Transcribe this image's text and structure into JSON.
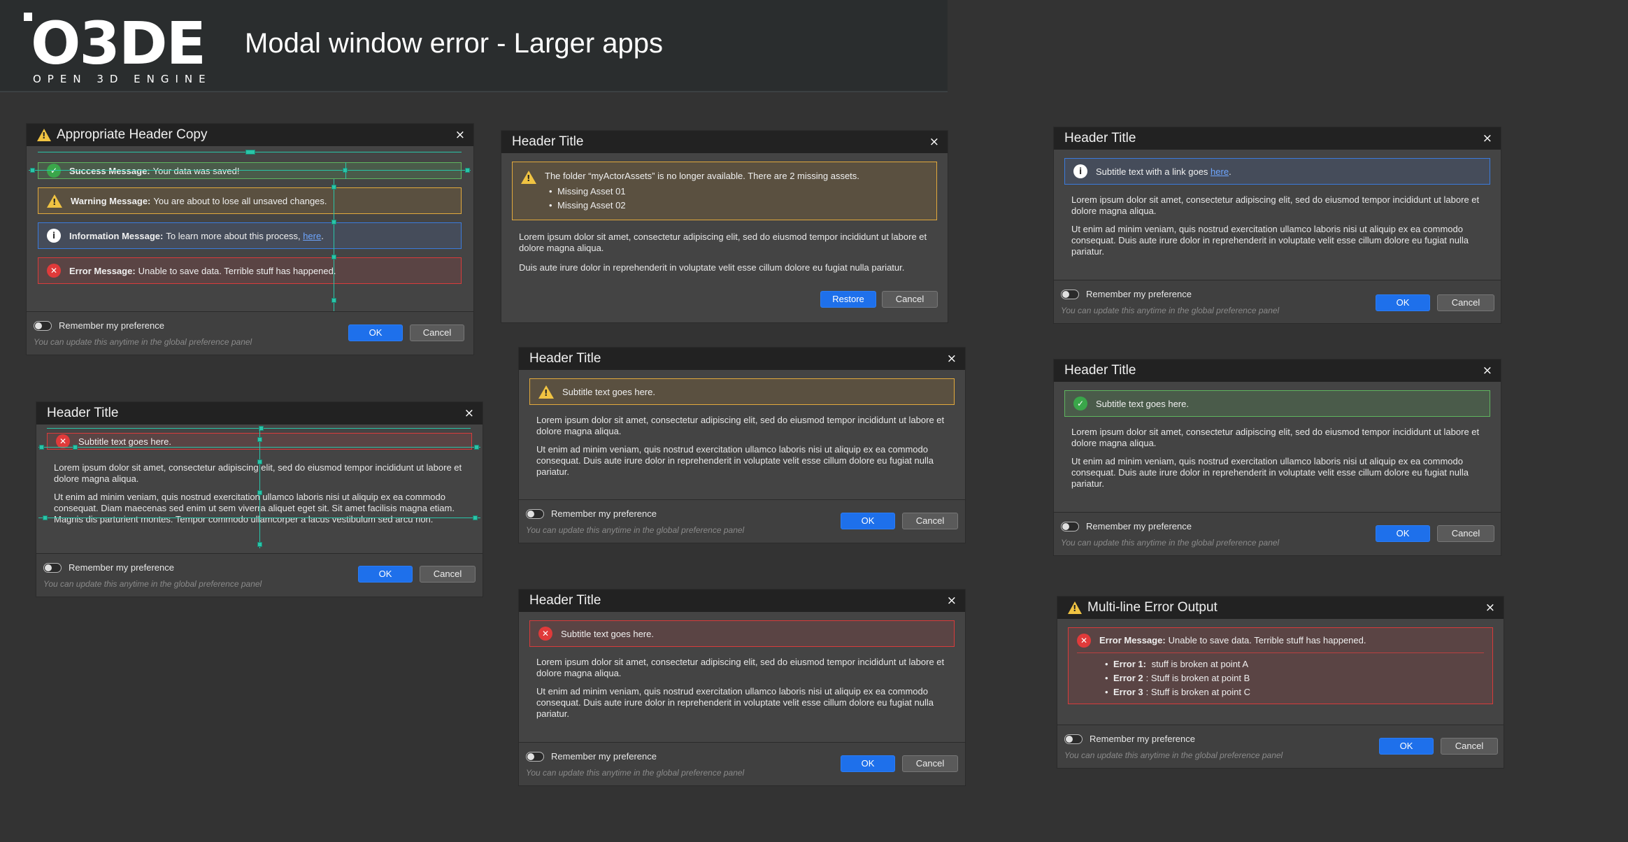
{
  "page": {
    "title": "Modal window error - Larger apps"
  },
  "logo": {
    "main": "O3DE",
    "sub": "OPEN 3D ENGINE"
  },
  "common": {
    "ok": "OK",
    "cancel": "Cancel",
    "restore": "Restore",
    "remember": "Remember my preference",
    "hint": "You can update this anytime in the global preference panel",
    "close": "×",
    "lorem1": "Lorem ipsum dolor sit amet, consectetur adipiscing elit, sed do eiusmod tempor incididunt ut labore et dolore magna aliqua.",
    "lorem2": "Ut enim ad minim veniam, quis nostrud exercitation ullamco laboris nisi ut aliquip ex ea commodo consequat. Duis aute irure dolor in reprehenderit in voluptate velit esse cillum dolore eu fugiat nulla pariatur.",
    "lorem3": "Duis aute irure dolor in reprehenderit in voluptate velit esse cillum dolore eu fugiat nulla pariatur.",
    "lorem4": "Ut enim ad minim veniam, quis nostrud exercitation ullamco laboris nisi ut aliquip ex ea commodo consequat. Diam maecenas sed enim ut sem viverra aliquet eget sit. Sit amet facilisis magna etiam. Magnis dis parturient montes. Tempor commodo ullamcorper a lacus vestibulum sed arcu non.",
    "subtitle": "Subtitle text goes here."
  },
  "m1": {
    "title": "Appropriate Header Copy",
    "success_label": "Success Message:",
    "success_text": "Your data was saved!",
    "warning_label": "Warning Message:",
    "warning_text": "You are about to lose all unsaved changes.",
    "info_label": "Information Message:",
    "info_text": "To learn more about this process, ",
    "info_link": "here",
    "error_label": "Error Message:",
    "error_text": "Unable to save data. Terrible stuff has happened.",
    "guide_label": "8px"
  },
  "m2": {
    "title": "Header Title",
    "warn_text": "The folder “myActorAssets” is no longer available. There are 2 missing assets.",
    "assets": [
      "Missing Asset 01",
      "Missing Asset 02"
    ]
  },
  "m3": {
    "title": "Header Title",
    "info_text": "Subtitle text with a link goes ",
    "info_link": "here"
  },
  "m4": {
    "title": "Header Title"
  },
  "m5": {
    "title": "Header Title"
  },
  "m6": {
    "title": "Header Title"
  },
  "m7": {
    "title": "Header Title"
  },
  "m8": {
    "title": "Multi-line Error Output",
    "error_label": "Error Message:",
    "error_text": "Unable to save data. Terrible stuff has happened.",
    "errors": [
      {
        "label": "Error 1:",
        "text": "stuff is broken at point A"
      },
      {
        "label": "Error 2",
        "text": ": Stuff is broken at point B"
      },
      {
        "label": "Error 3",
        "text": ": Stuff is broken at point C"
      }
    ]
  }
}
